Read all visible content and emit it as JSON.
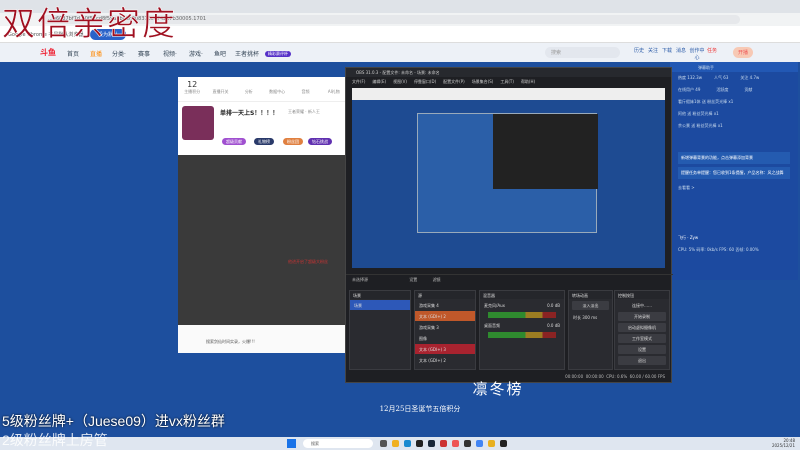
{
  "browser": {
    "tab_close": "×",
    "url": "...b6087bf7d...0f51cd8f59a2b83c008370c0742e7b30005.1701",
    "info_text": "Google Chrome 不是默认浏览器",
    "info_button": "设为默认",
    "window_controls": [
      "–",
      "▢",
      "×"
    ]
  },
  "site_nav": {
    "logo": "斗鱼",
    "items": [
      "首页",
      "直播",
      "分类·",
      "赛事",
      "视频·",
      "游戏·",
      "鱼吧",
      "王者挑杯"
    ],
    "promo": "精彩赛评杯",
    "search_placeholder": "搜索",
    "icons": [
      "历史",
      "关注",
      "下载",
      "消息",
      "创作中心",
      "任务"
    ],
    "live_button": "开播"
  },
  "left_panel": {
    "stats": [
      {
        "value": "12",
        "label": "主播积分"
      },
      {
        "value": "",
        "label": "直播开关"
      },
      {
        "value": "",
        "label": "分析"
      },
      {
        "value": "",
        "label": "数据中心"
      },
      {
        "value": "",
        "label": "音频"
      },
      {
        "value": "",
        "label": "AI礼物"
      }
    ],
    "room_title": "单排一天上S！！！！",
    "room_meta": "王者荣耀 · 新人王",
    "tags": [
      "超级贡献",
      "礼物榜",
      "粉丝团",
      "钻石挑战"
    ],
    "chat_notice": "他进开启了超级大粉丝",
    "bottom_text": "搜索剑仙时间实录，火爆!!!"
  },
  "obs": {
    "title": "OBS 31.0.3 - 配置文件: 未命名 - 场景: 未命名",
    "menu": [
      "文件(F)",
      "编辑(E)",
      "视图(V)",
      "停靠窗口(D)",
      "配置文件(P)",
      "场景集合(S)",
      "工具(T)",
      "帮助(H)"
    ],
    "source_bar": {
      "label": "未选择源",
      "settings": "设置",
      "filters": "滤镜"
    },
    "docks": {
      "scenes": {
        "title": "场景",
        "items": [
          "场景"
        ]
      },
      "sources": {
        "title": "源",
        "items": [
          "游戏采集 4",
          "文本 (GDI+) 2",
          "游戏采集 3",
          "图像",
          "文本 (GDI+) 3",
          "文本 (GDI+) 2"
        ]
      },
      "mixer": {
        "title": "混音器",
        "channels": [
          {
            "name": "麦克风/Aux",
            "db": "0.0 dB"
          },
          {
            "name": "桌面音频",
            "db": "0.0 dB"
          }
        ]
      },
      "transitions": {
        "title": "转场动画",
        "type": "淡入淡出",
        "duration_label": "时长",
        "duration": "300 ms"
      },
      "controls": {
        "title": "控制按钮",
        "status": "连接中……",
        "buttons": [
          "开始录制",
          "启动虚拟摄像机",
          "工作室模式",
          "设置",
          "退出"
        ]
      }
    },
    "status": {
      "rec": "00:00:00",
      "stream": "00:00:00",
      "cpu": "CPU: 0.6%",
      "fps": "60.00 / 60.00 FPS"
    }
  },
  "right_panel": {
    "title": "弹幕助手",
    "stats": [
      "热度 132.3w",
      "人气 63",
      "关注 4.7w"
    ],
    "tabs": [
      "在线用户 49",
      "活跃度",
      "贡献"
    ],
    "messages": [
      "看斤假妹1休 送 粉丝荧光棒 x1",
      "阿他 送 粉丝荧光棒 x1",
      "余公景 送 粉丝荧光棒 x1"
    ],
    "notices": [
      "新增弹幕背景的功能，点击弹幕添加背景",
      "提醒任务单提醒：您已收到1条提醒，产品名称：风之战舞",
      "去看看 >"
    ],
    "footer_user": "飞行 · Zyw",
    "footer_stats": "CPU: 5%  码率: 0kb/s  FPS: 60  丢帧: 0.00%"
  },
  "event": {
    "banner": "凛冬榜",
    "subtitle": "12月25日圣诞节五倍积分"
  },
  "overlays": {
    "top": "双倍亲密度",
    "bottom1": "5级粉丝牌+（Juese09）进vx粉丝群",
    "bottom2": "2级粉丝牌上房管"
  },
  "taskbar": {
    "search": "搜索",
    "time": "20:48",
    "date": "2025/12/21"
  }
}
